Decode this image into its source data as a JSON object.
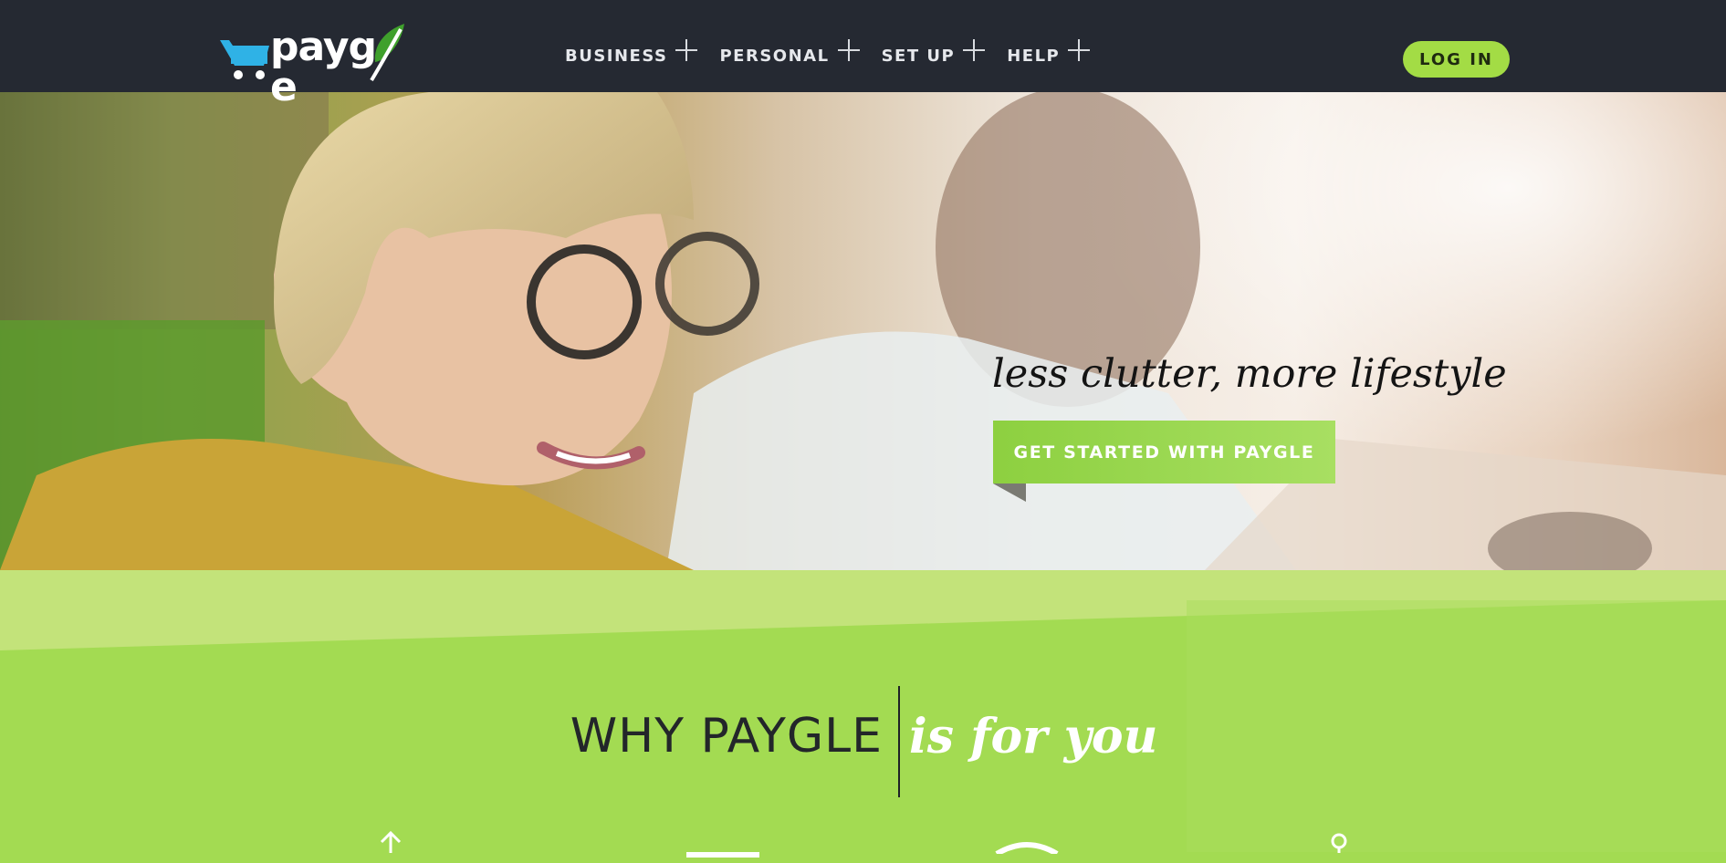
{
  "header": {
    "brand": {
      "logo_text": "payg",
      "logo_tail": "e",
      "cart_icon": "shopping-cart-icon",
      "leaf_icon": "leaf-icon"
    },
    "nav": [
      {
        "label": "BUSINESS",
        "icon": "plus-icon"
      },
      {
        "label": "PERSONAL",
        "icon": "plus-icon"
      },
      {
        "label": "SET UP",
        "icon": "plus-icon"
      },
      {
        "label": "HELP",
        "icon": "plus-icon"
      }
    ],
    "login_label": "LOG IN"
  },
  "hero": {
    "tagline": "less clutter, more lifestyle",
    "cta_label": "GET STARTED WITH PAYGLE"
  },
  "why_section": {
    "heading_left": "WHY PAYGLE",
    "heading_right": "is for you",
    "feature_icons": [
      "arrow-up-icon",
      "feature-icon",
      "feature-icon",
      "location-pin-icon"
    ]
  },
  "colors": {
    "header_bg": "#252932",
    "accent_green": "#a3dc45",
    "band_green": "#a3db52",
    "band_light_green": "#c3e37a",
    "cart_blue": "#2fb2e6",
    "leaf_green": "#3fa02c"
  }
}
